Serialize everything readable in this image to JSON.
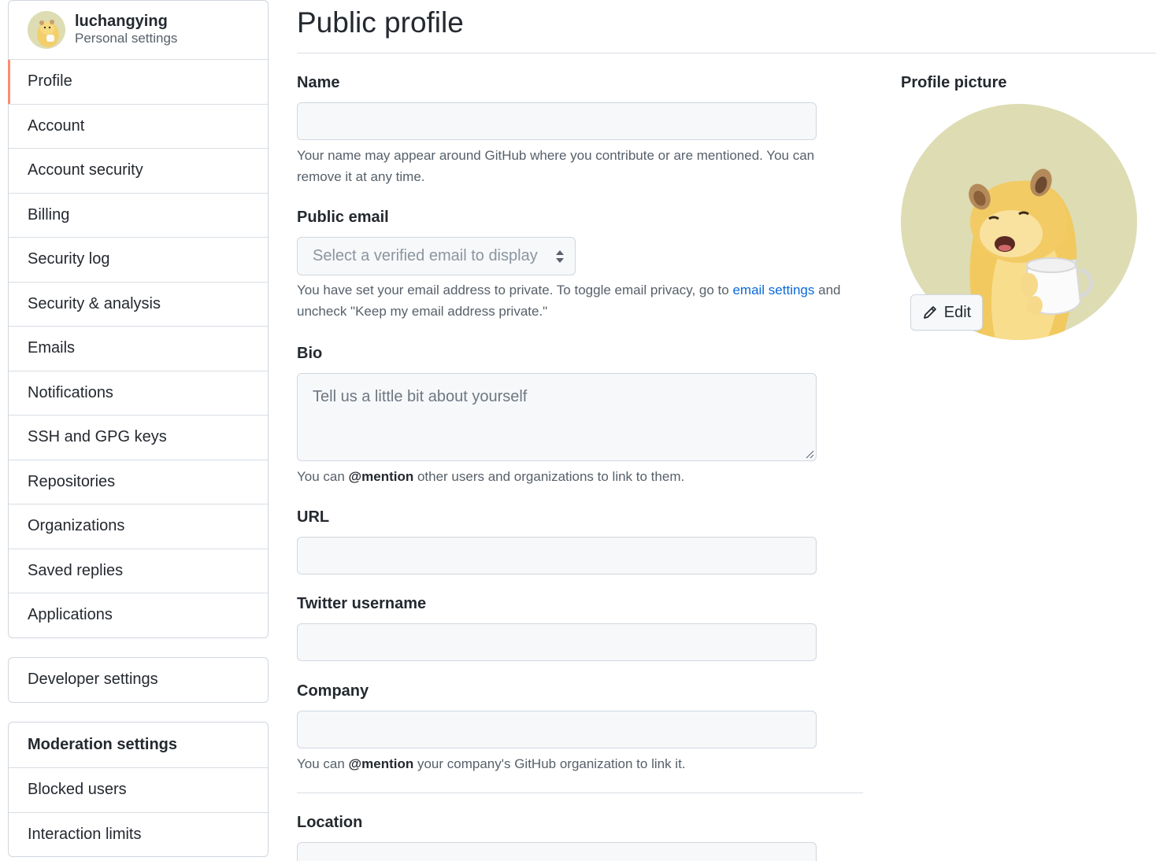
{
  "user": {
    "username": "luchangying",
    "subtitle": "Personal settings"
  },
  "sidebar": {
    "items": [
      {
        "label": "Profile",
        "selected": true
      },
      {
        "label": "Account"
      },
      {
        "label": "Account security"
      },
      {
        "label": "Billing"
      },
      {
        "label": "Security log"
      },
      {
        "label": "Security & analysis"
      },
      {
        "label": "Emails"
      },
      {
        "label": "Notifications"
      },
      {
        "label": "SSH and GPG keys"
      },
      {
        "label": "Repositories"
      },
      {
        "label": "Organizations"
      },
      {
        "label": "Saved replies"
      },
      {
        "label": "Applications"
      }
    ],
    "developer_settings": "Developer settings",
    "moderation": {
      "title": "Moderation settings",
      "items": [
        "Blocked users",
        "Interaction limits"
      ]
    }
  },
  "main": {
    "title": "Public profile",
    "name": {
      "label": "Name",
      "value": "",
      "note": "Your name may appear around GitHub where you contribute or are mentioned. You can remove it at any time."
    },
    "public_email": {
      "label": "Public email",
      "selected": "Select a verified email to display",
      "note_before": "You have set your email address to private. To toggle email privacy, go to ",
      "note_link": "email settings",
      "note_after": " and uncheck \"Keep my email address private.\""
    },
    "bio": {
      "label": "Bio",
      "placeholder": "Tell us a little bit about yourself",
      "note_before": "You can ",
      "note_mention": "@mention",
      "note_after": " other users and organizations to link to them."
    },
    "url": {
      "label": "URL",
      "value": ""
    },
    "twitter": {
      "label": "Twitter username",
      "value": ""
    },
    "company": {
      "label": "Company",
      "value": "",
      "note_before": "You can ",
      "note_mention": "@mention",
      "note_after": " your company's GitHub organization to link it."
    },
    "location": {
      "label": "Location",
      "value": ""
    }
  },
  "profile_picture": {
    "label": "Profile picture",
    "edit_label": "Edit"
  },
  "colors": {
    "accent_selected": "#fd8c73",
    "link": "#0969da",
    "avatar_bg": "#dddcb3"
  },
  "icons": {
    "edit": "pencil-icon",
    "select": "select-arrows-icon",
    "resize": "resize-grip-icon"
  }
}
